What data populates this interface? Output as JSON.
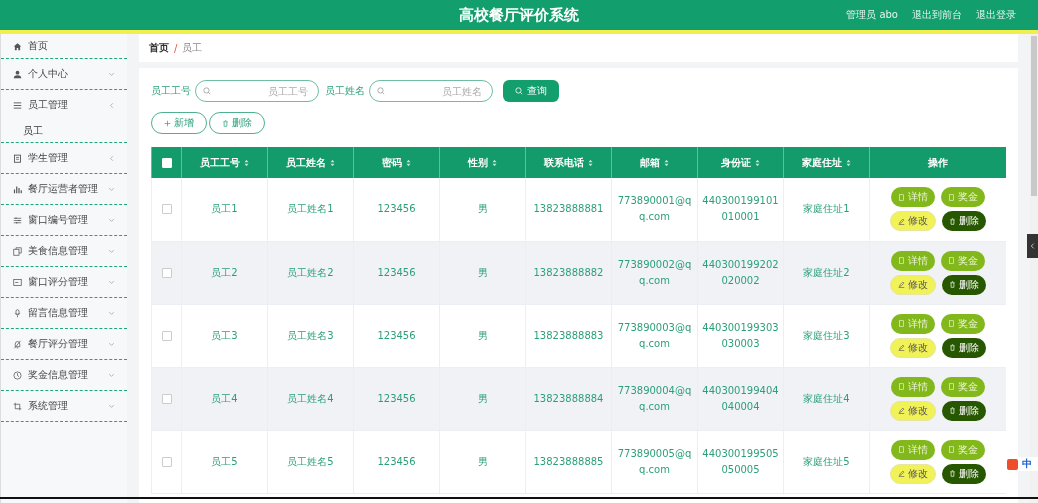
{
  "header": {
    "title": "高校餐厅评价系统",
    "user": "管理员 abo",
    "links": [
      "退出到前台",
      "退出登录"
    ]
  },
  "sidebar": {
    "items": [
      {
        "label": "首页",
        "expandable": false
      },
      {
        "label": "个人中心",
        "expandable": true,
        "expanded": false
      },
      {
        "label": "员工管理",
        "expandable": true,
        "expanded": true,
        "children": [
          {
            "label": "员工"
          }
        ]
      },
      {
        "label": "学生管理",
        "expandable": true,
        "expanded": true
      },
      {
        "label": "餐厅运营者管理",
        "expandable": true,
        "expanded": false
      },
      {
        "label": "窗口编号管理",
        "expandable": true,
        "expanded": false
      },
      {
        "label": "美食信息管理",
        "expandable": true,
        "expanded": false
      },
      {
        "label": "窗口评分管理",
        "expandable": true,
        "expanded": false
      },
      {
        "label": "留言信息管理",
        "expandable": true,
        "expanded": false
      },
      {
        "label": "餐厅评分管理",
        "expandable": true,
        "expanded": false
      },
      {
        "label": "奖金信息管理",
        "expandable": true,
        "expanded": false
      },
      {
        "label": "系统管理",
        "expandable": true,
        "expanded": false
      }
    ]
  },
  "breadcrumb": {
    "items": [
      "首页",
      "员工"
    ],
    "separator": "/"
  },
  "search": {
    "fields": [
      {
        "label": "员工工号",
        "placeholder": "员工工号"
      },
      {
        "label": "员工姓名",
        "placeholder": "员工姓名"
      }
    ],
    "button": "查询"
  },
  "toolbar": [
    "新增",
    "删除"
  ],
  "table": {
    "all_checked": false,
    "columns": [
      "员工工号",
      "员工姓名",
      "密码",
      "性别",
      "联系电话",
      "邮箱",
      "身份证",
      "家庭住址",
      "操作"
    ],
    "rows": [
      {
        "checked": false,
        "cells": [
          "员工1",
          "员工姓名1",
          "123456",
          "男",
          "13823888881",
          "773890001@qq.com",
          "440300199101010001",
          "家庭住址1"
        ],
        "actions": [
          {
            "kind": "detail",
            "label": "详情"
          },
          {
            "kind": "bonus",
            "label": "奖金"
          },
          {
            "kind": "edit",
            "label": "修改"
          },
          {
            "kind": "delete",
            "label": "删除"
          }
        ]
      },
      {
        "checked": false,
        "cells": [
          "员工2",
          "员工姓名2",
          "123456",
          "男",
          "13823888882",
          "773890002@qq.com",
          "440300199202020002",
          "家庭住址2"
        ],
        "actions": [
          {
            "kind": "detail",
            "label": "详情"
          },
          {
            "kind": "bonus",
            "label": "奖金"
          },
          {
            "kind": "edit",
            "label": "修改"
          },
          {
            "kind": "delete",
            "label": "删除"
          }
        ]
      },
      {
        "checked": false,
        "cells": [
          "员工3",
          "员工姓名3",
          "123456",
          "男",
          "13823888883",
          "773890003@qq.com",
          "440300199303030003",
          "家庭住址3"
        ],
        "actions": [
          {
            "kind": "detail",
            "label": "详情"
          },
          {
            "kind": "bonus",
            "label": "奖金"
          },
          {
            "kind": "edit",
            "label": "修改"
          },
          {
            "kind": "delete",
            "label": "删除"
          }
        ]
      },
      {
        "checked": false,
        "cells": [
          "员工4",
          "员工姓名4",
          "123456",
          "男",
          "13823888884",
          "773890004@qq.com",
          "440300199404040004",
          "家庭住址4"
        ],
        "actions": [
          {
            "kind": "detail",
            "label": "详情"
          },
          {
            "kind": "bonus",
            "label": "奖金"
          },
          {
            "kind": "edit",
            "label": "修改"
          },
          {
            "kind": "delete",
            "label": "删除"
          }
        ]
      },
      {
        "checked": false,
        "cells": [
          "员工5",
          "员工姓名5",
          "123456",
          "男",
          "13823888885",
          "773890005@qq.com",
          "440300199505050005",
          "家庭住址5"
        ],
        "actions": [
          {
            "kind": "detail",
            "label": "详情"
          },
          {
            "kind": "bonus",
            "label": "奖金"
          },
          {
            "kind": "edit",
            "label": "修改"
          },
          {
            "kind": "delete",
            "label": "删除"
          }
        ]
      }
    ]
  },
  "ime_toolbar": {
    "mode": "中"
  }
}
